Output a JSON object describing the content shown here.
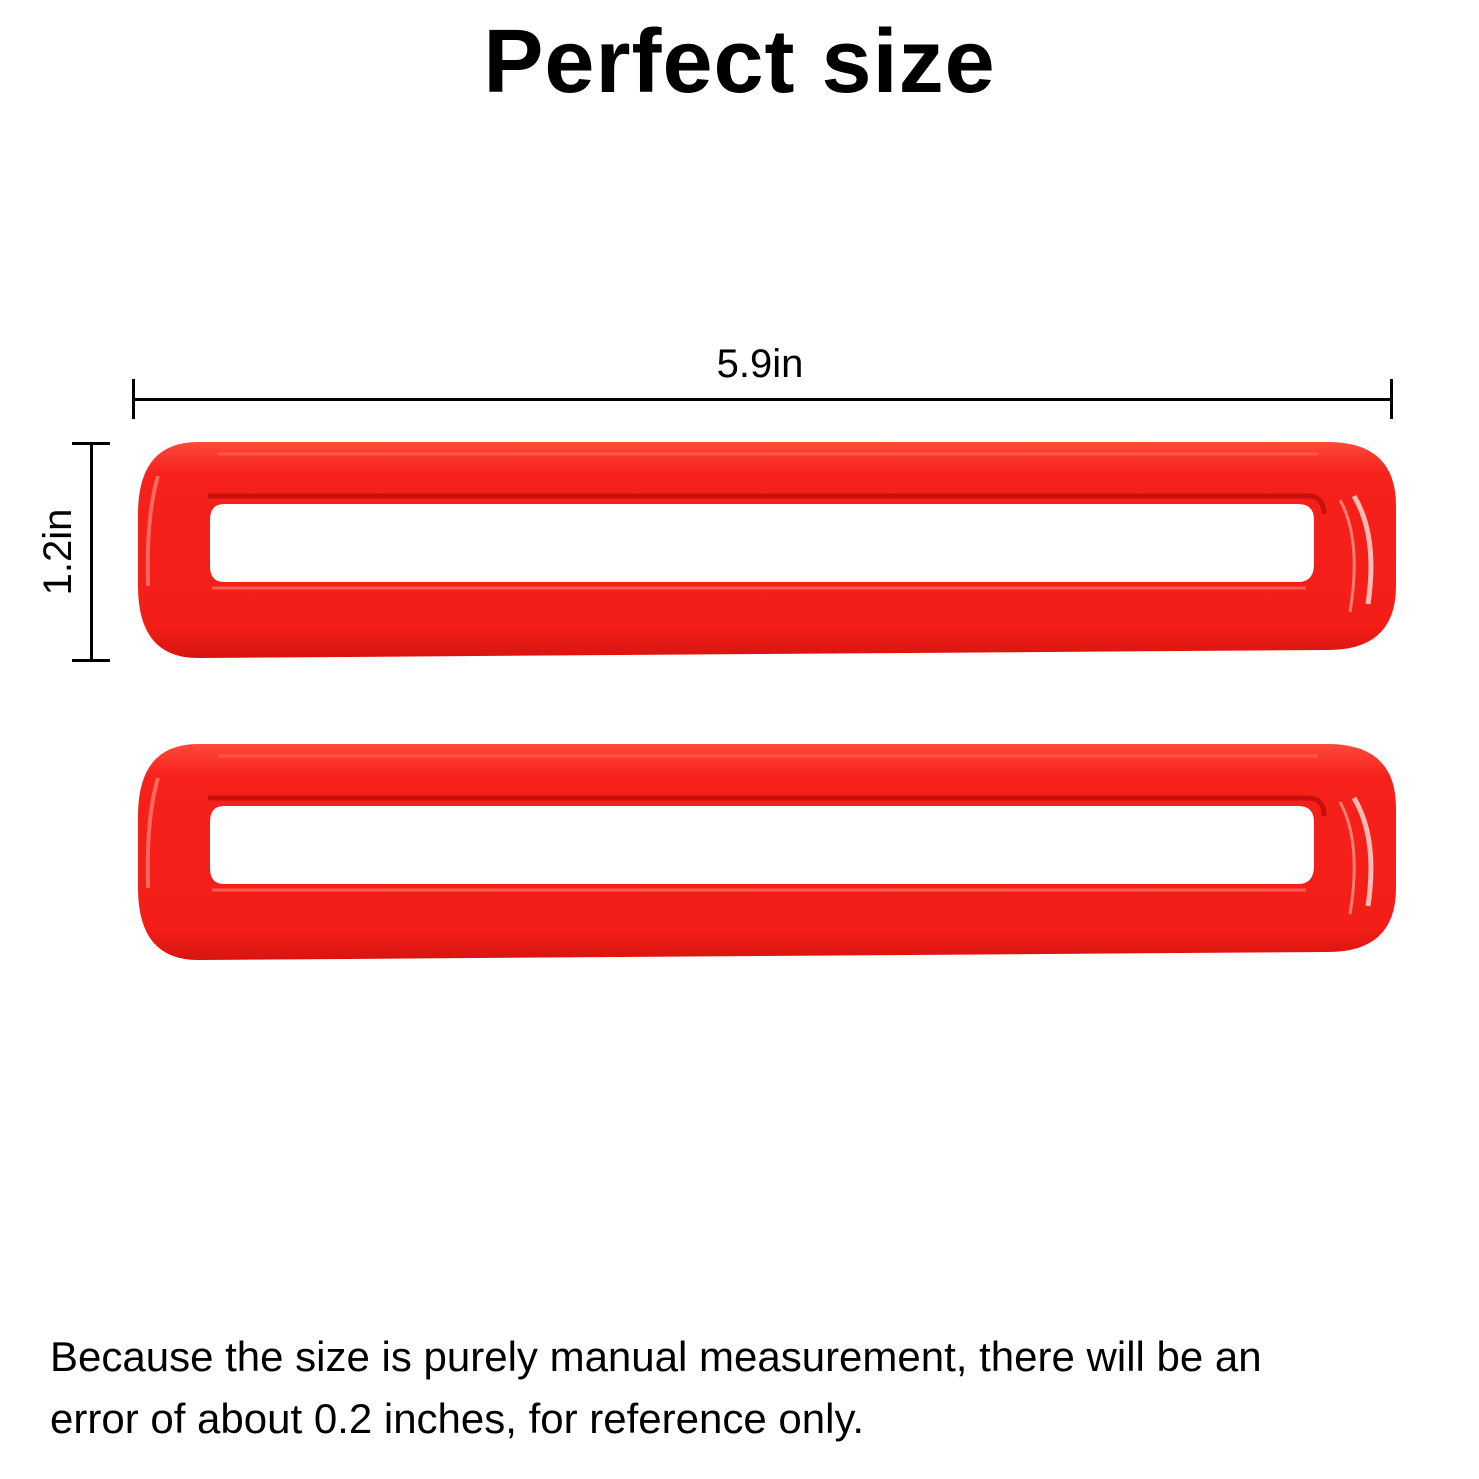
{
  "title": "Perfect size",
  "dimensions": {
    "width_label": "5.9in",
    "height_label": "1.2in"
  },
  "products": [
    {
      "name": "red frame trim top",
      "color": "#f6211b"
    },
    {
      "name": "red frame trim bottom",
      "color": "#f6211b"
    }
  ],
  "colors": {
    "frame_red": "#f6211b",
    "frame_highlight": "#ff6b5c",
    "frame_shadow": "#c80f0c",
    "background": "#ffffff",
    "text": "#000000"
  },
  "note": {
    "line1": "Because the size is purely manual measurement, there will be an",
    "line2": "error of about 0.2 inches, for reference only."
  }
}
